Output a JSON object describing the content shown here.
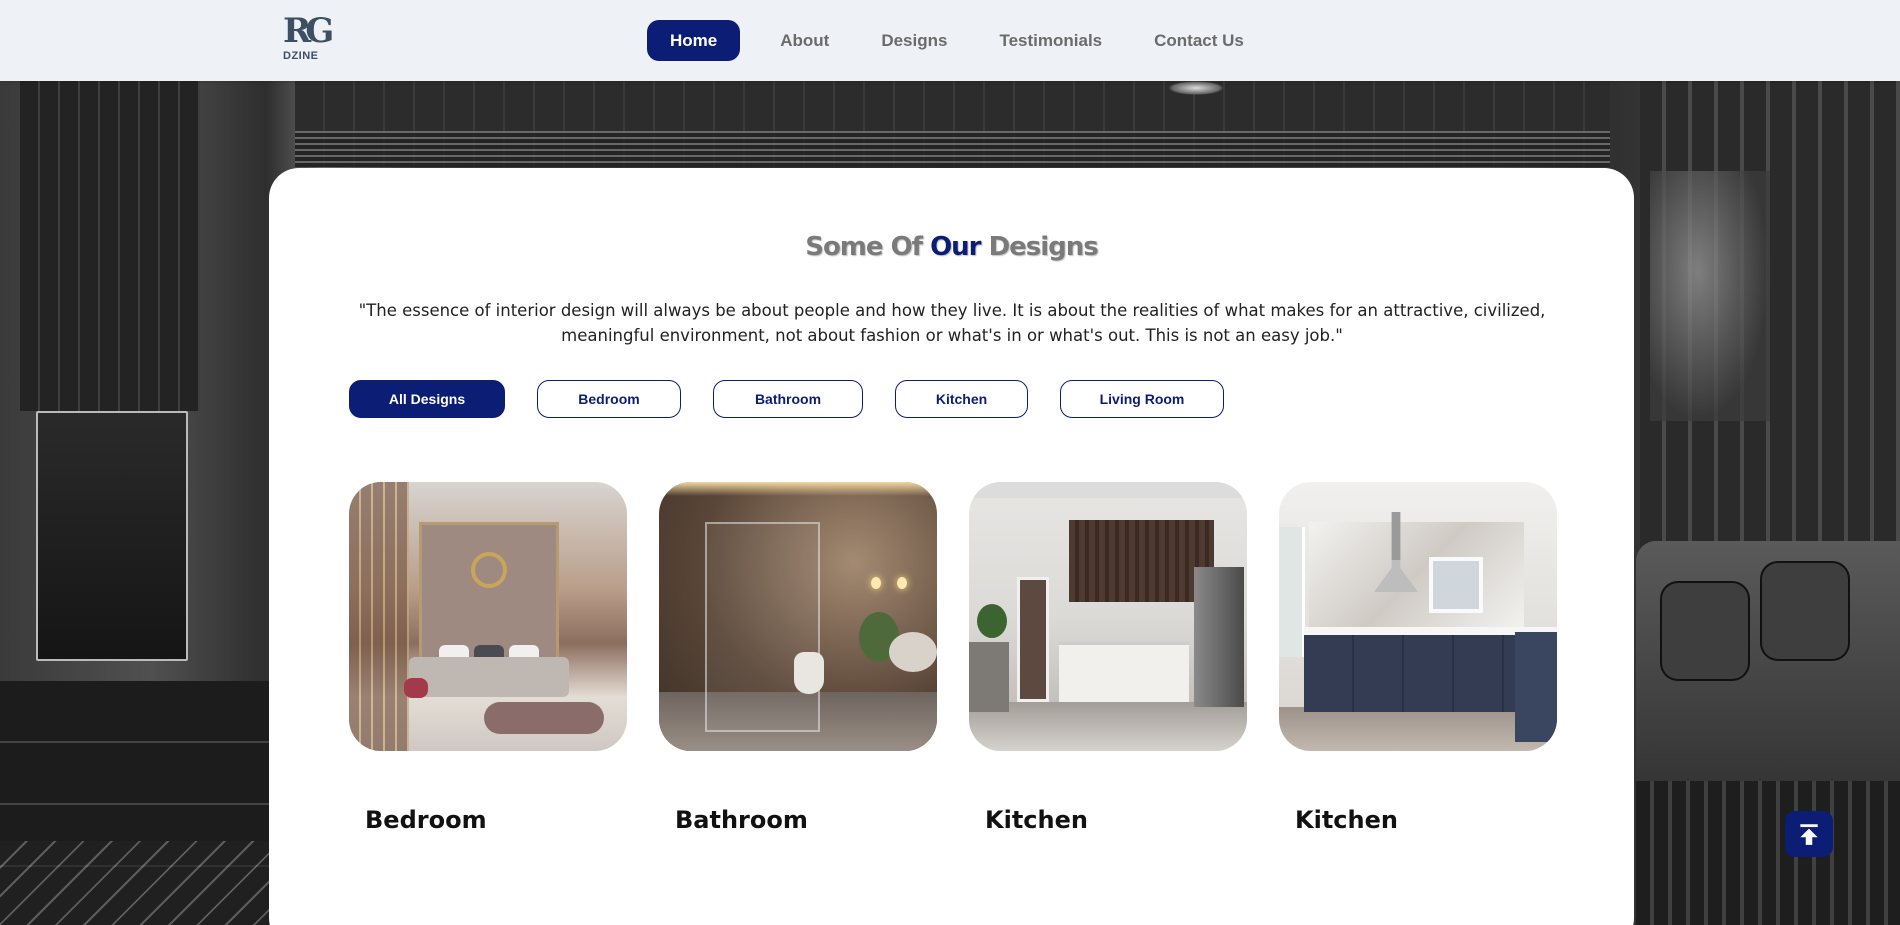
{
  "header": {
    "logo_mark": "RG",
    "logo_word": "DZINE",
    "nav": [
      {
        "label": "Home"
      },
      {
        "label": "About"
      },
      {
        "label": "Designs"
      },
      {
        "label": "Testimonials"
      },
      {
        "label": "Contact Us"
      }
    ],
    "active_nav": "Home"
  },
  "section": {
    "title_part1": "Some Of",
    "title_accent": "Our",
    "title_part2": "Designs",
    "quote": "\"The essence of interior design will always be about people and how they live. It is about the realities of what makes for an attractive, civilized, meaningful environment, not about fashion or what's in or what's out. This is not an easy job.\""
  },
  "filters": [
    {
      "label": "All Designs",
      "active": true
    },
    {
      "label": "Bedroom",
      "active": false
    },
    {
      "label": "Bathroom",
      "active": false
    },
    {
      "label": "Kitchen",
      "active": false
    },
    {
      "label": "Living Room",
      "active": false
    }
  ],
  "designs": [
    {
      "label": "Bedroom",
      "image": "bedroom-interior-photo"
    },
    {
      "label": "Bathroom",
      "image": "bathroom-interior-photo"
    },
    {
      "label": "Kitchen",
      "image": "kitchen-interior-photo"
    },
    {
      "label": "Kitchen",
      "image": "kitchen-interior-photo"
    }
  ],
  "back_to_top_icon": "arrow-up-to-line-icon",
  "colors": {
    "accent": "#0b1d74",
    "header_bg": "#eef2f7",
    "title_gray": "#7a7a7a"
  }
}
